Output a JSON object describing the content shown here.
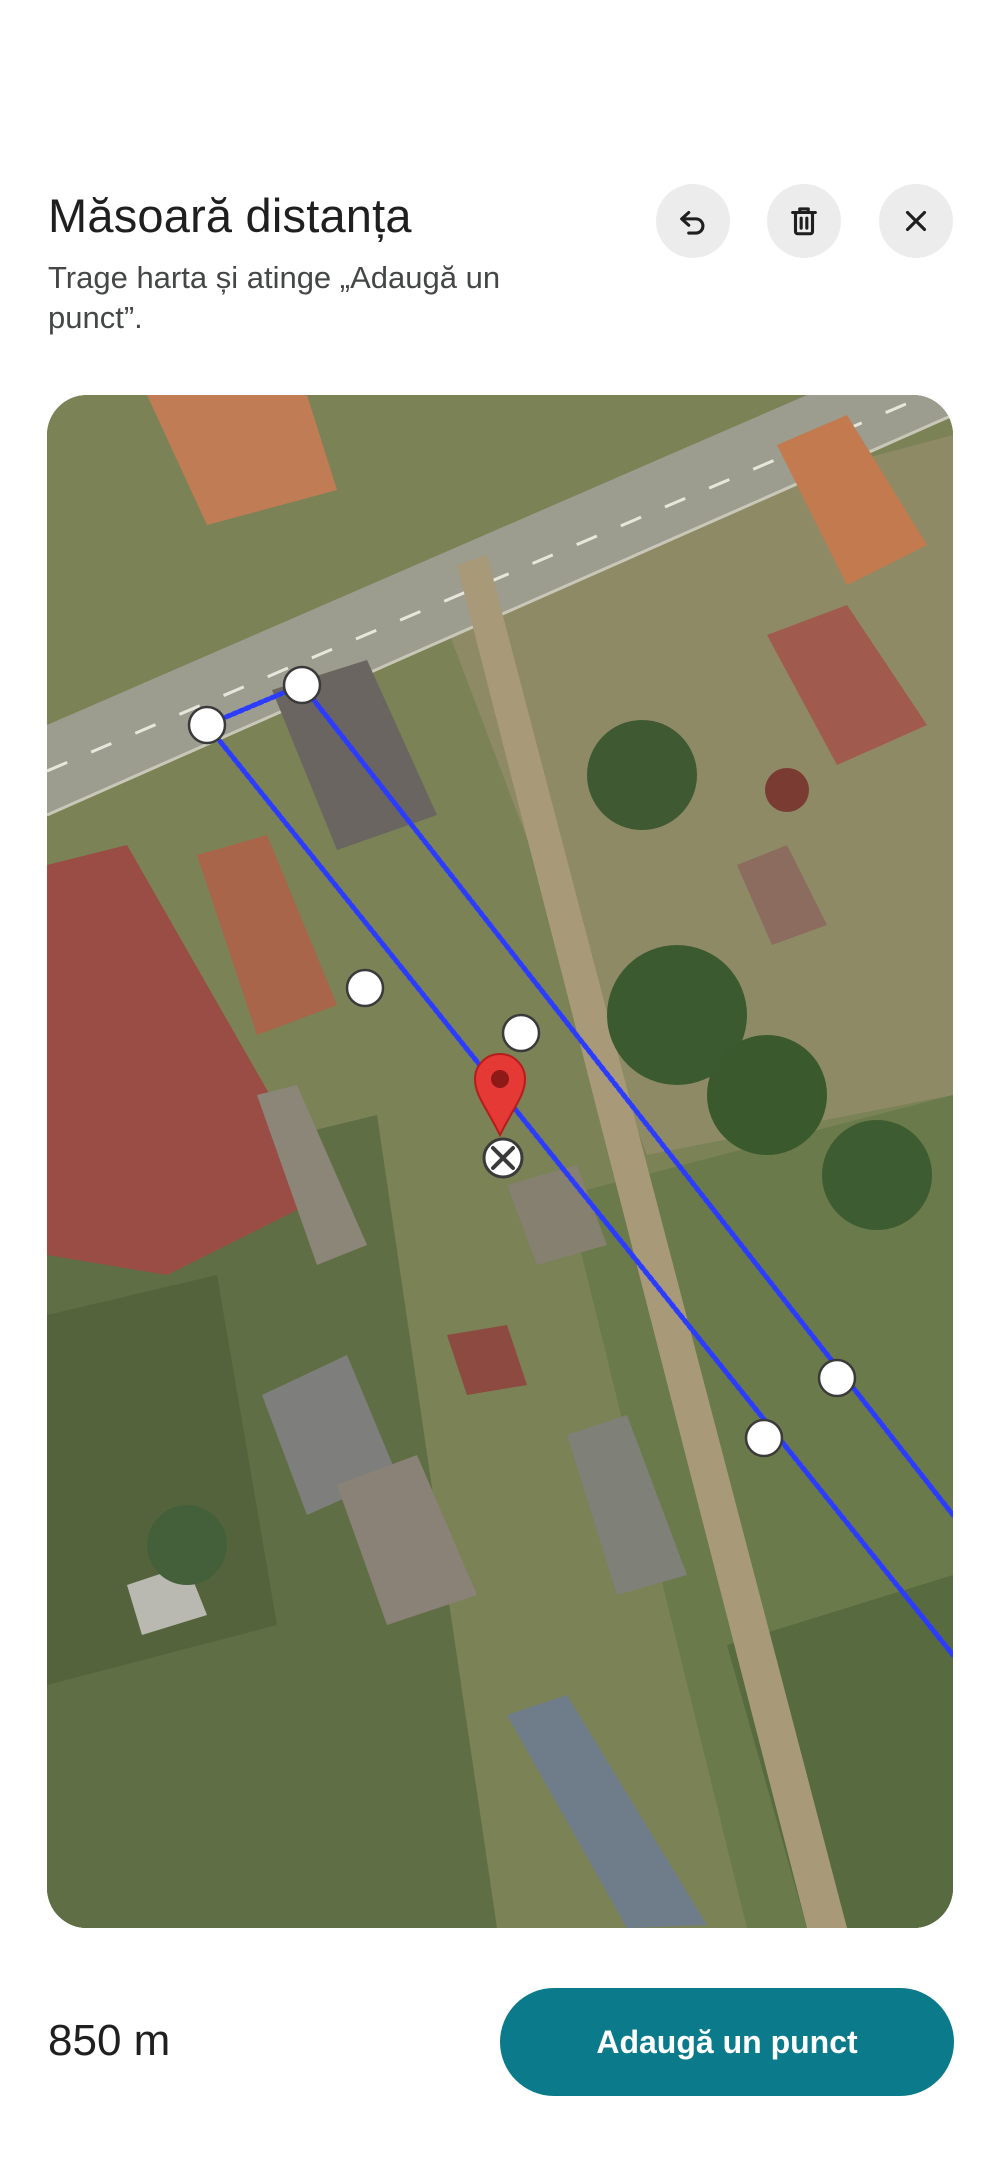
{
  "header": {
    "title": "Măsoară distanța",
    "subtitle": "Trage harta și atinge „Adaugă un punct”."
  },
  "toolbar": {
    "undo_icon": "undo-icon",
    "delete_icon": "trash-icon",
    "close_icon": "close-icon"
  },
  "map": {
    "line_color": "#2b3cff",
    "pin_color": "#e53935"
  },
  "footer": {
    "distance": "850 m",
    "add_point_label": "Adaugă un punct",
    "accent": "#0b7a8a"
  }
}
